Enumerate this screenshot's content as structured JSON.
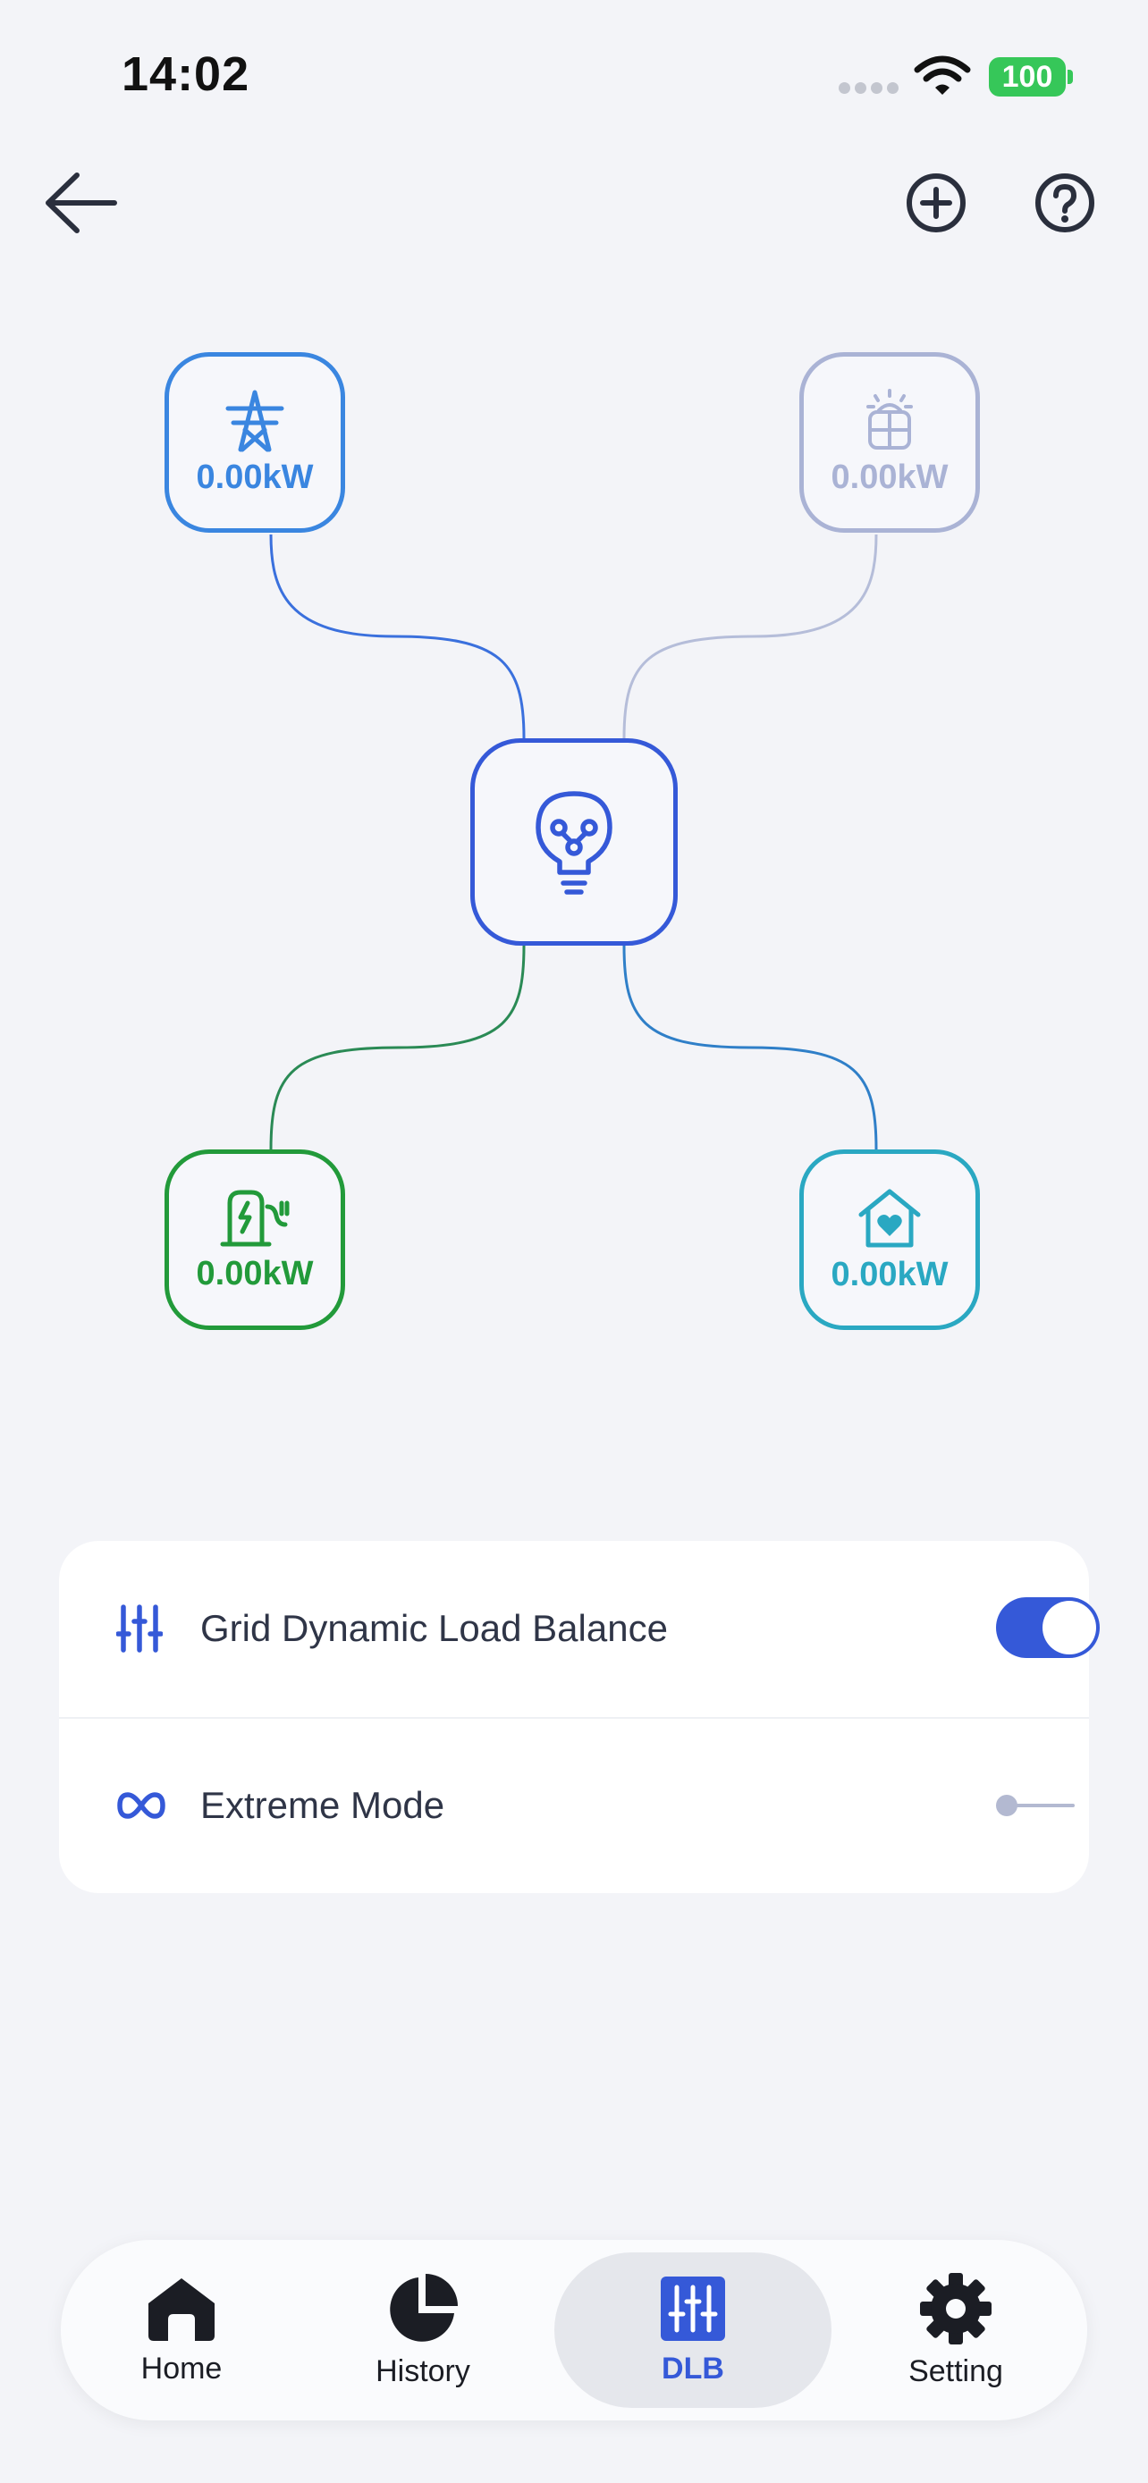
{
  "status_bar": {
    "time": "14:02",
    "battery": "100"
  },
  "header": {
    "back_icon": "arrow-left-icon",
    "add_icon": "plus-circle-icon",
    "help_icon": "question-circle-icon"
  },
  "flow": {
    "grid": {
      "value": "0.00kW",
      "icon": "power-tower-icon",
      "color": "#3a86e0"
    },
    "solar": {
      "value": "0.00kW",
      "icon": "solar-panel-icon",
      "color": "#aab3d5"
    },
    "hub": {
      "icon": "lightbulb-icon",
      "color": "#3559d8"
    },
    "charger": {
      "value": "0.00kW",
      "icon": "ev-charger-icon",
      "color": "#229a3a"
    },
    "home": {
      "value": "0.00kW",
      "icon": "home-heart-icon",
      "color": "#2aa8c2"
    }
  },
  "settings": {
    "rows": [
      {
        "label": "Grid Dynamic Load Balance",
        "icon": "sliders-icon",
        "enabled": true
      },
      {
        "label": "Extreme Mode",
        "icon": "infinity-icon",
        "enabled": false
      }
    ]
  },
  "tabbar": {
    "tabs": [
      {
        "label": "Home",
        "icon": "home-icon"
      },
      {
        "label": "History",
        "icon": "pie-chart-icon"
      },
      {
        "label": "DLB",
        "icon": "dlb-sliders-icon",
        "active": true
      },
      {
        "label": "Setting",
        "icon": "gear-icon"
      }
    ]
  },
  "colors": {
    "accent": "#3559d8",
    "toggle_off": "#b3b9d1",
    "background": "#f3f4f8"
  }
}
